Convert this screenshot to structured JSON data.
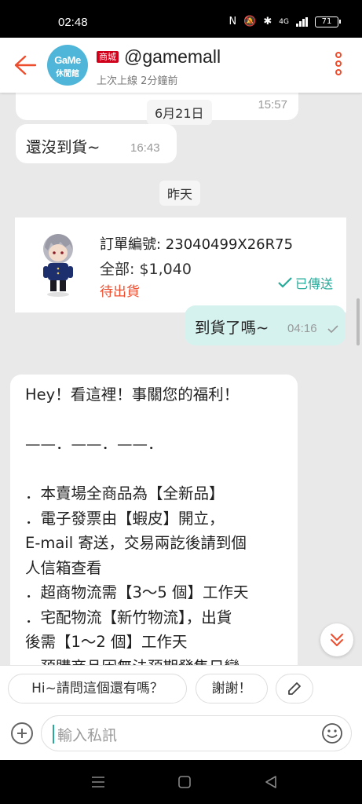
{
  "status_bar": {
    "time": "02:48",
    "network": "4G",
    "battery": "71"
  },
  "header": {
    "avatar_line1": "GaMe",
    "avatar_line2": "休閒館",
    "badge": "商城",
    "shop_name": "@gamemall",
    "last_seen": "上次上線 2分鐘前"
  },
  "messages": {
    "partial_time": "15:57",
    "date_1": "6月21日",
    "msg1": {
      "text": "還沒到貨~",
      "time": "16:43"
    },
    "date_2": "昨天",
    "order": {
      "number": "訂單編號: 23040499X26R75",
      "total": "全部: $1,040",
      "status": "待出貨",
      "sent_label": "已傳送"
    },
    "msg2": {
      "text": "到貨了嗎~",
      "time": "04:16"
    },
    "long_text": "Hey！看這裡！事關您的福利！\n\n——．——．——．\n\n．本賣場全商品為【全新品】\n．電子發票由【蝦皮】開立，\nE-mail 寄送，交易兩訖後請到個\n人信箱查看\n．超商物流需【3～5 個】工作天\n．宅配物流【新竹物流】，出貨\n後需【1～2 個】工作天\n．預購商品因無法預期發售日變"
  },
  "quick_replies": [
    "Hi~請問這個還有嗎？",
    "謝謝！"
  ],
  "input": {
    "placeholder": "輸入私訊"
  },
  "colors": {
    "accent": "#ee4d2d",
    "teal": "#26aa99",
    "outgoing_bubble": "#d5f2ef"
  }
}
